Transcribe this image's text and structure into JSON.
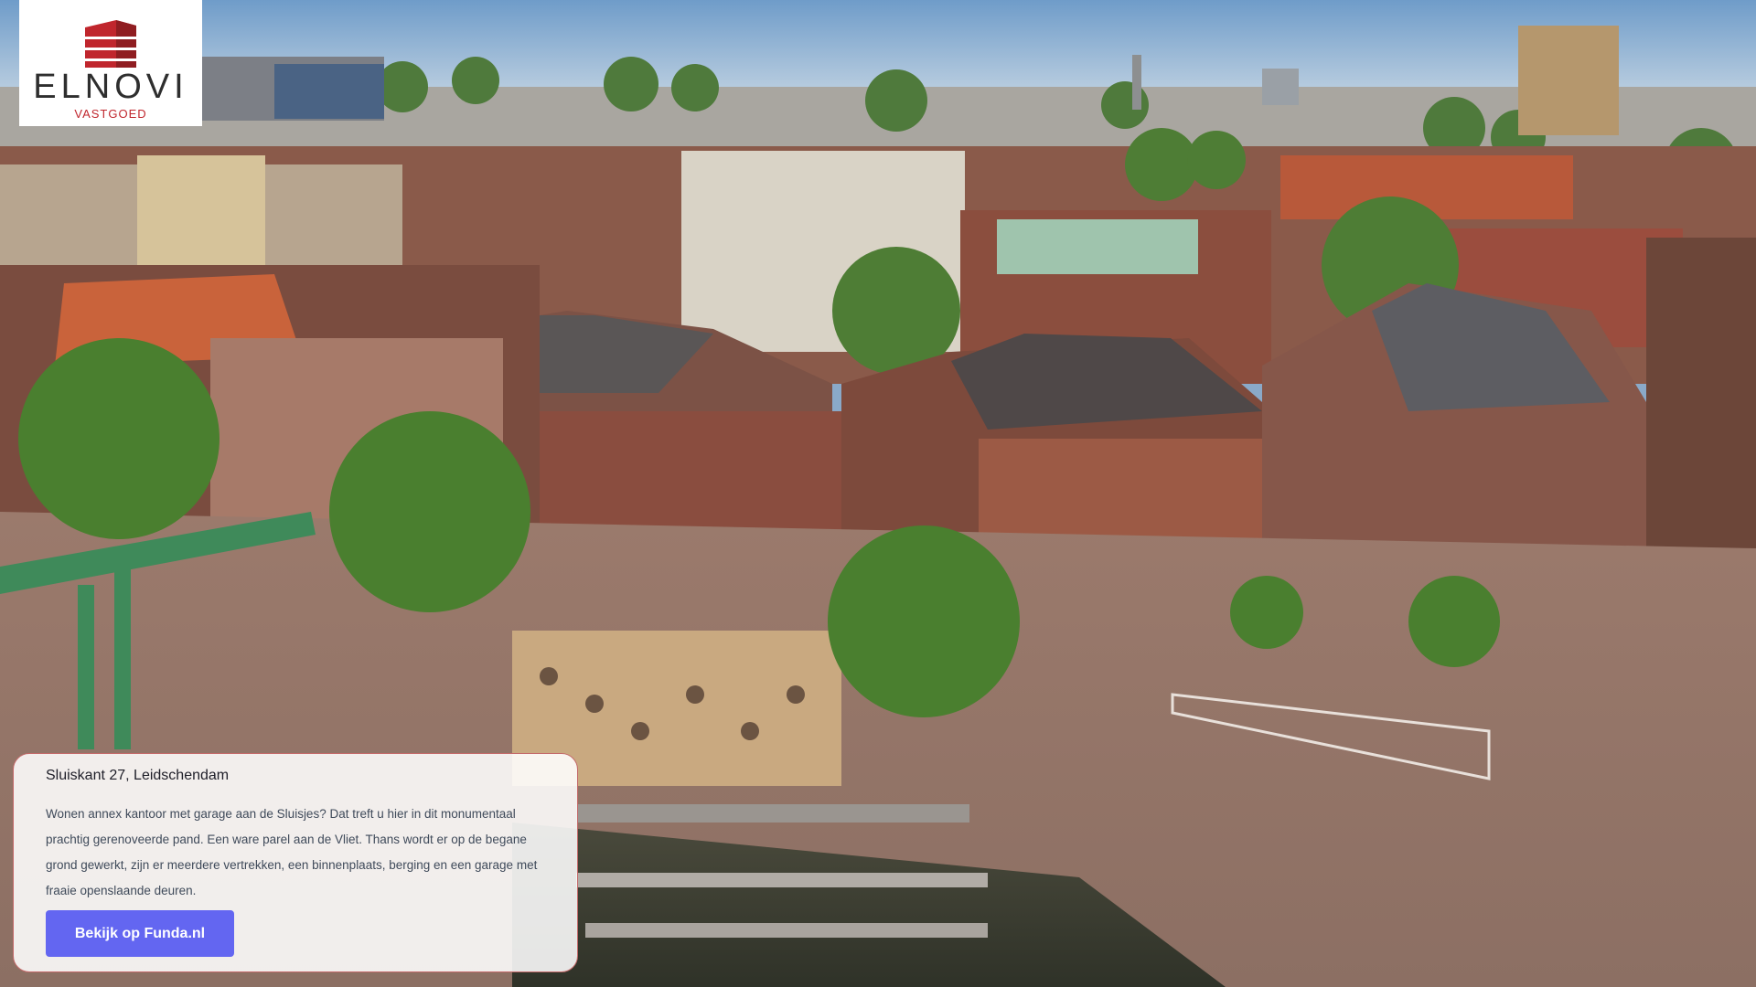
{
  "logo": {
    "wordmark": "ELNOVI",
    "tagline": "VASTGOED",
    "icon": "stacked-bars-building-icon",
    "brand_color": "#c0262d"
  },
  "background": {
    "icon": "aerial-photo-canal-square-leidschendam"
  },
  "listing": {
    "address": "Sluiskant 27, Leidschendam",
    "description": "Wonen annex kantoor met garage aan de Sluisjes? Dat treft u hier in dit monumentaal prachtig gerenoveerde pand. Een ware parel aan de Vliet. Thans wordt er op de begane grond gewerkt, zijn er meerdere vertrekken, een binnenplaats, berging en een garage met fraaie openslaande deuren.",
    "button_label": "Bekijk op Funda.nl",
    "accent_color": "#6366f1"
  }
}
